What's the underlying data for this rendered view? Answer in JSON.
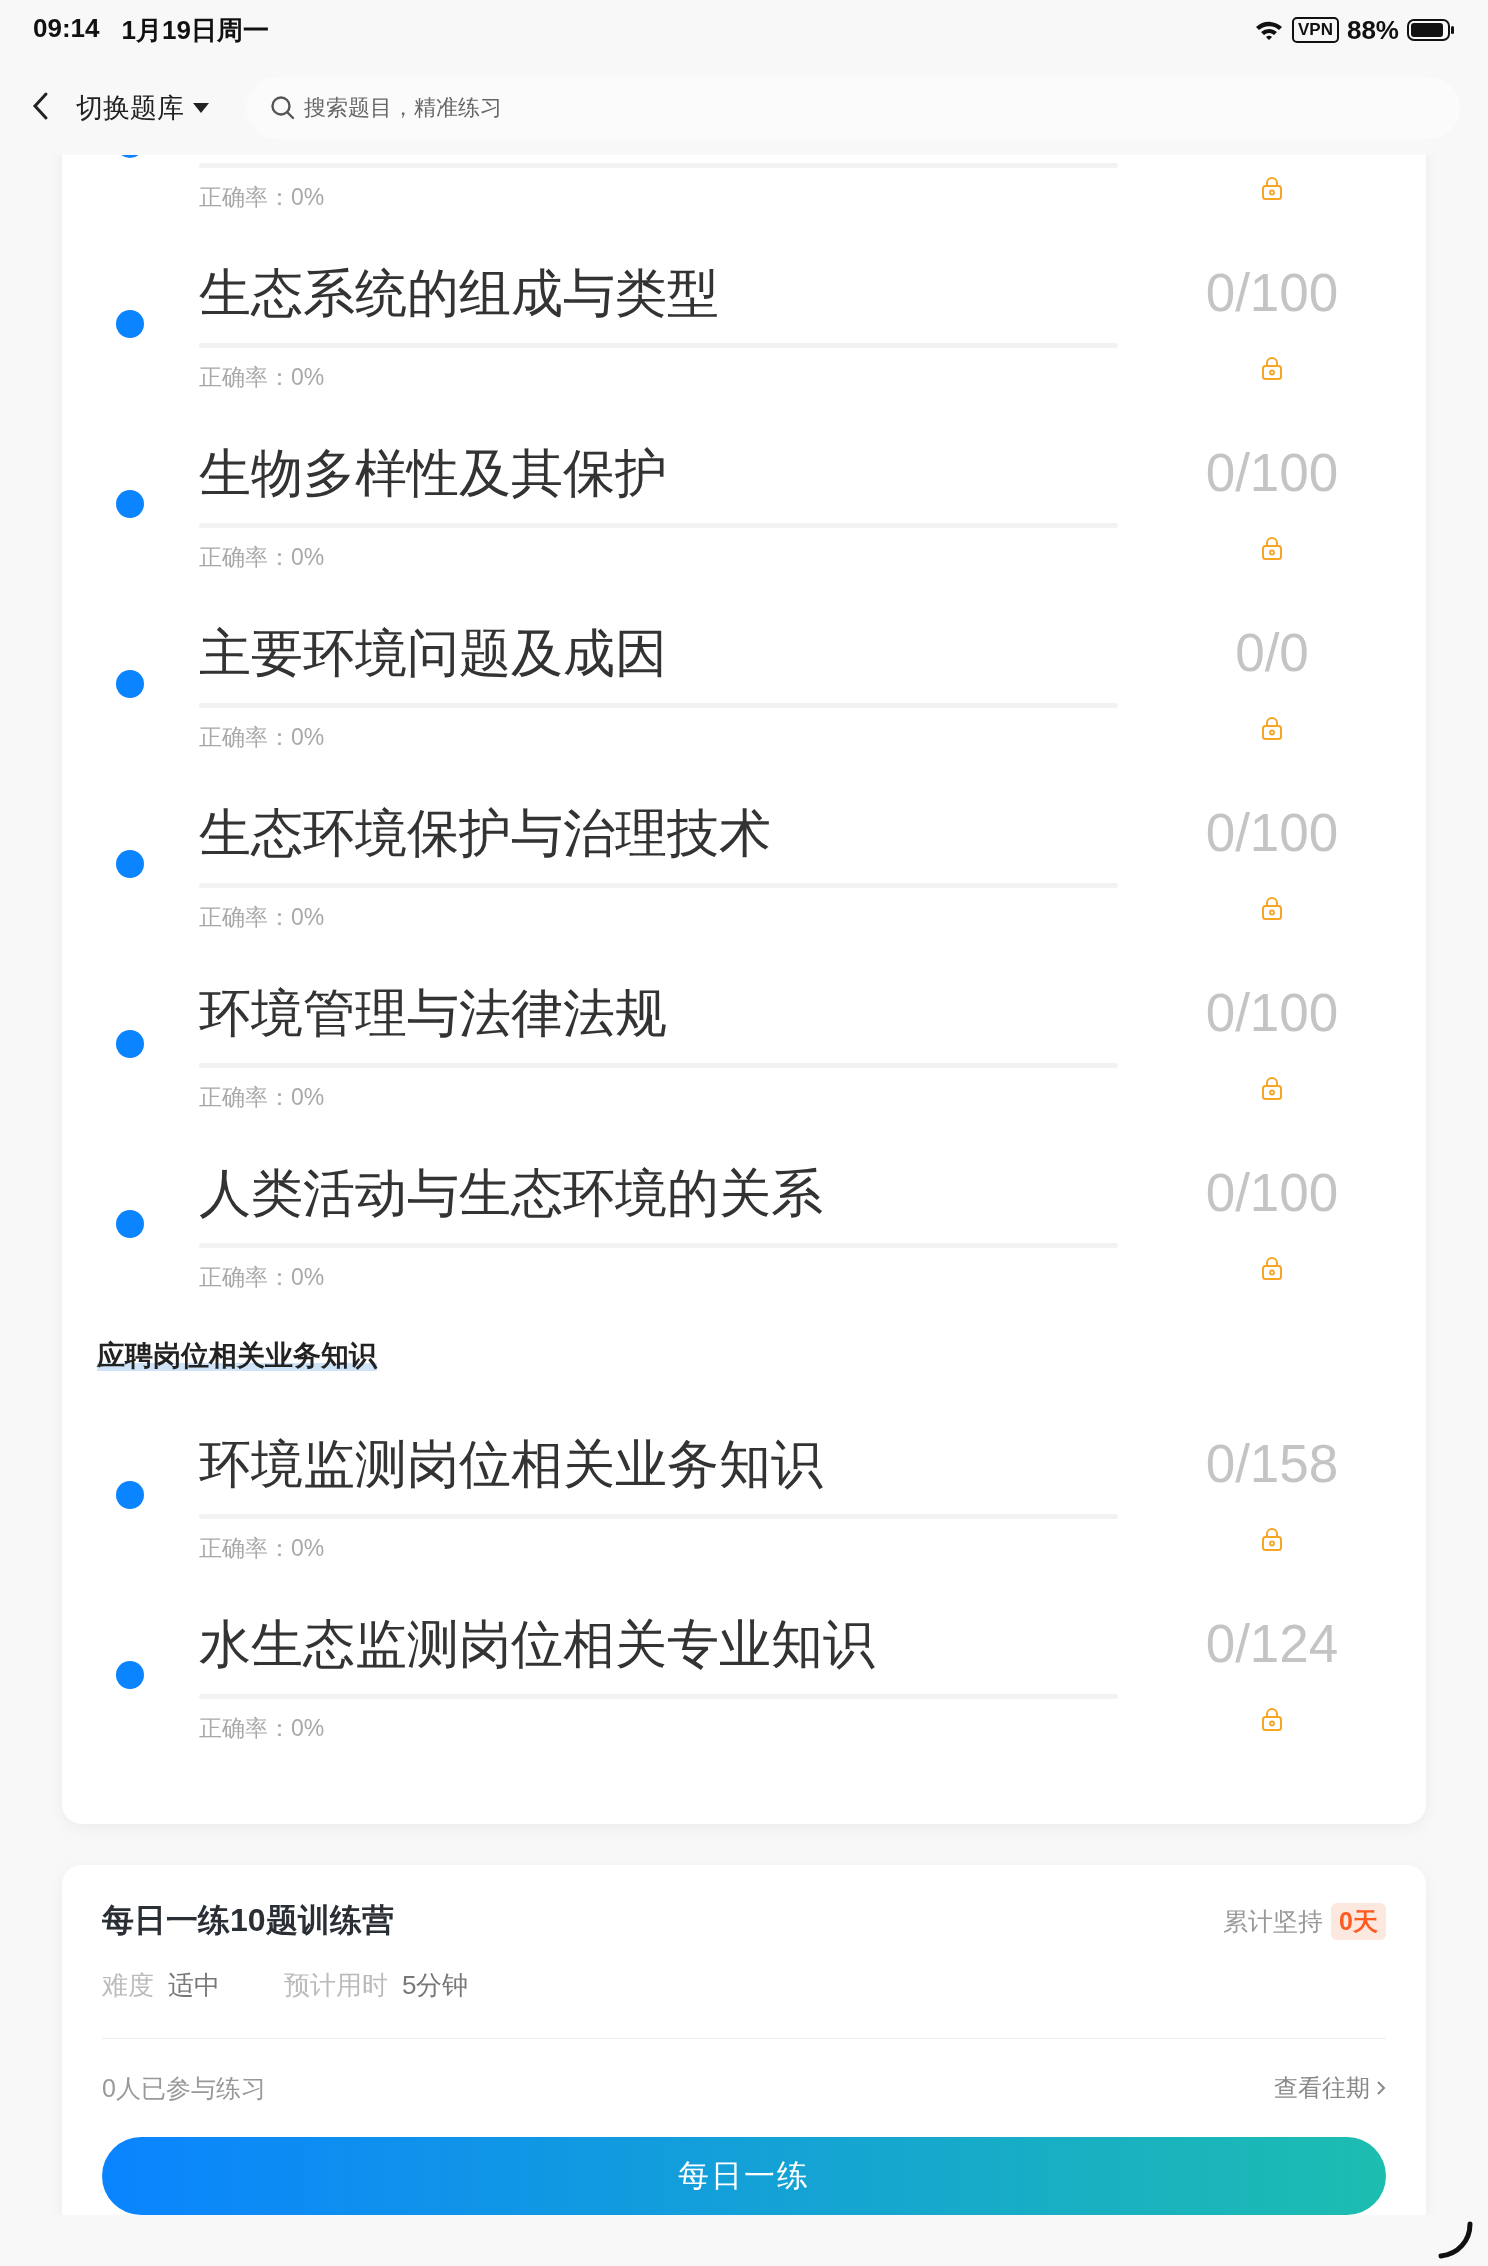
{
  "status_bar": {
    "time": "09:14",
    "date": "1月19日周一",
    "vpn": "VPN",
    "battery": "88%"
  },
  "nav": {
    "switch_label": "切换题库",
    "search": {
      "placeholder": "搜索题目，精准练习"
    }
  },
  "sections": [
    {
      "chapters": [
        {
          "accuracy": "正确率：0%",
          "level": 0,
          "locked": true
        },
        {
          "title": "生态系统的组成与类型",
          "count": "0/100",
          "accuracy": "正确率：0%",
          "level": 0,
          "locked": true
        },
        {
          "title": "生物多样性及其保护",
          "count": "0/100",
          "accuracy": "正确率：0%",
          "level": 0,
          "locked": true
        },
        {
          "title": "主要环境问题及成因",
          "count": "0/0",
          "accuracy": "正确率：0%",
          "level": 0,
          "locked": true
        },
        {
          "title": "生态环境保护与治理技术",
          "count": "0/100",
          "accuracy": "正确率：0%",
          "level": 0,
          "locked": true
        },
        {
          "title": "环境管理与法律法规",
          "count": "0/100",
          "accuracy": "正确率：0%",
          "level": 0,
          "locked": true
        },
        {
          "title": "人类活动与生态环境的关系",
          "count": "0/100",
          "accuracy": "正确率：0%",
          "level": 0,
          "locked": true
        }
      ]
    },
    {
      "heading": "应聘岗位相关业务知识",
      "chapters": [
        {
          "title": "环境监测岗位相关业务知识",
          "count": "0/158",
          "accuracy": "正确率：0%",
          "level": 0,
          "locked": true
        },
        {
          "title": "水生态监测岗位相关专业知识",
          "count": "0/124",
          "accuracy": "正确率：0%",
          "level": 0,
          "locked": true
        }
      ]
    }
  ],
  "daily": {
    "title": "每日一练10题训练营",
    "streak_label": "累计坚持",
    "streak": "0天",
    "difficulty_label": "难度",
    "difficulty": "适中",
    "time_label": "预计用时",
    "time": "5分钟",
    "participants": "0人已参与练习",
    "history_link": "查看往期",
    "button": "每日一练"
  }
}
